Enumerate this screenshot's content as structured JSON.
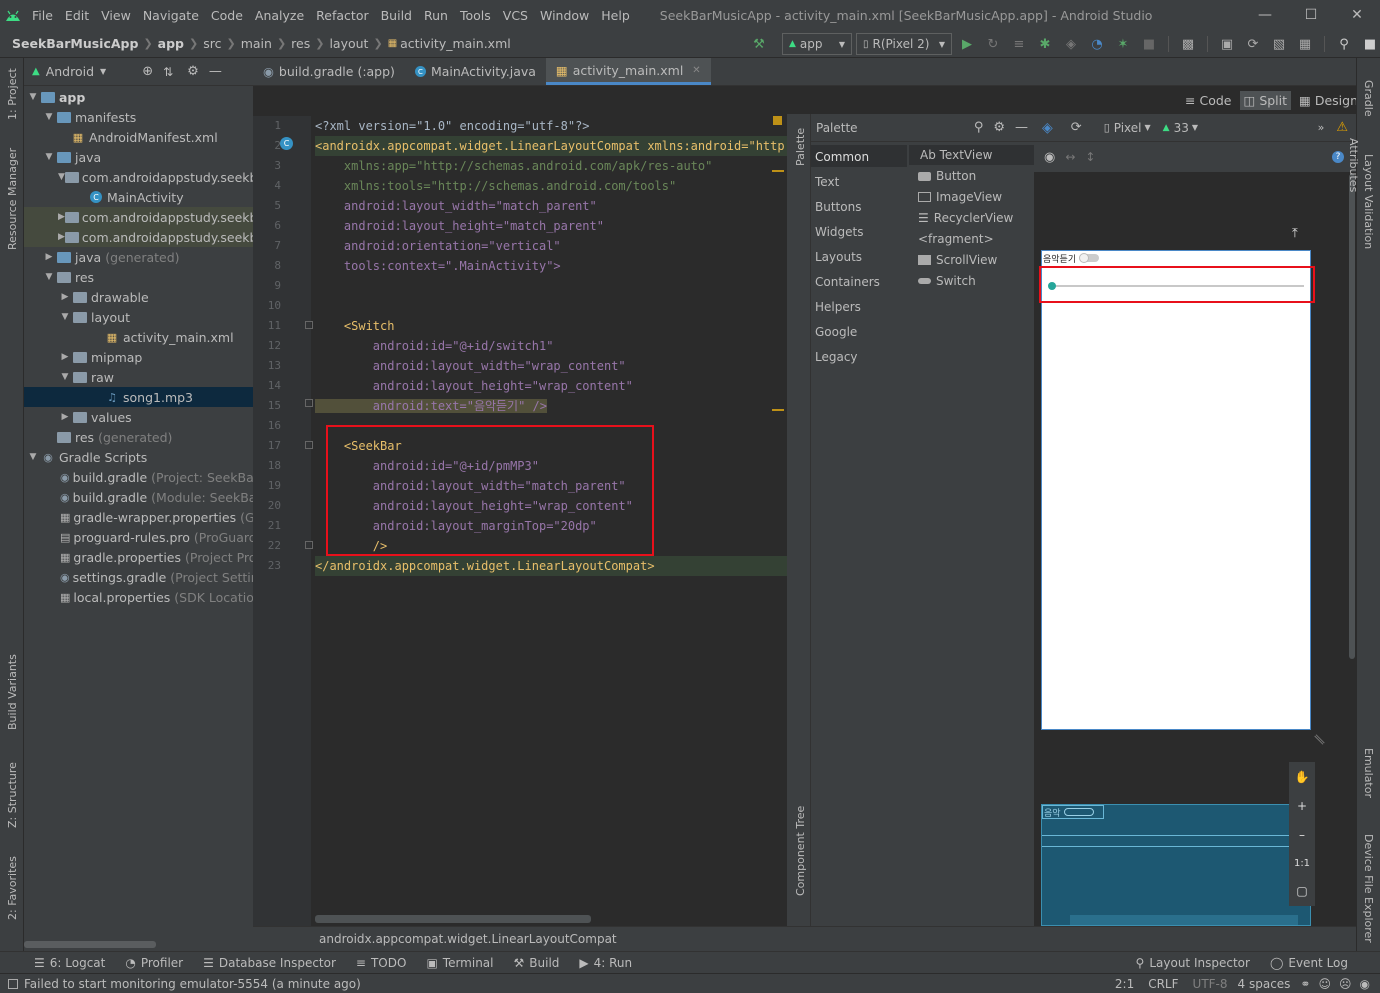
{
  "titlebar": {
    "menu": [
      "File",
      "Edit",
      "View",
      "Navigate",
      "Code",
      "Analyze",
      "Refactor",
      "Build",
      "Run",
      "Tools",
      "VCS",
      "Window",
      "Help"
    ],
    "title": "SeekBarMusicApp - activity_main.xml [SeekBarMusicApp.app] - Android Studio"
  },
  "navbar": {
    "breadcrumbs": [
      "SeekBarMusicApp",
      "app",
      "src",
      "main",
      "res",
      "layout",
      "activity_main.xml"
    ],
    "run_config": "app",
    "device": "R(Pixel 2)"
  },
  "left_stripe": {
    "project": "1: Project",
    "resource_manager": "Resource Manager",
    "build_variants": "Build Variants",
    "structure": "Z: Structure",
    "favorites": "2: Favorites"
  },
  "project_panel": {
    "view_mode": "Android",
    "tree": [
      {
        "label": "app",
        "hint": ""
      },
      {
        "label": "manifests",
        "hint": ""
      },
      {
        "label": "AndroidManifest.xml",
        "hint": ""
      },
      {
        "label": "java",
        "hint": ""
      },
      {
        "label": "com.androidappstudy.seekba",
        "hint": ""
      },
      {
        "label": "MainActivity",
        "hint": ""
      },
      {
        "label": "com.androidappstudy.seekba",
        "hint": ""
      },
      {
        "label": "com.androidappstudy.seekba",
        "hint": ""
      },
      {
        "label": "java",
        "hint": "(generated)"
      },
      {
        "label": "res",
        "hint": ""
      },
      {
        "label": "drawable",
        "hint": ""
      },
      {
        "label": "layout",
        "hint": ""
      },
      {
        "label": "activity_main.xml",
        "hint": ""
      },
      {
        "label": "mipmap",
        "hint": ""
      },
      {
        "label": "raw",
        "hint": ""
      },
      {
        "label": "song1.mp3",
        "hint": ""
      },
      {
        "label": "values",
        "hint": ""
      },
      {
        "label": "res",
        "hint": "(generated)"
      },
      {
        "label": "Gradle Scripts",
        "hint": ""
      },
      {
        "label": "build.gradle",
        "hint": "(Project: SeekBarMu"
      },
      {
        "label": "build.gradle",
        "hint": "(Module: SeekBarM"
      },
      {
        "label": "gradle-wrapper.properties",
        "hint": "(Gradl"
      },
      {
        "label": "proguard-rules.pro",
        "hint": "(ProGuard Ru"
      },
      {
        "label": "gradle.properties",
        "hint": "(Project Proper"
      },
      {
        "label": "settings.gradle",
        "hint": "(Project Settings)"
      },
      {
        "label": "local.properties",
        "hint": "(SDK Location)"
      }
    ]
  },
  "tabs": [
    {
      "label": "build.gradle (:app)"
    },
    {
      "label": "MainActivity.java"
    },
    {
      "label": "activity_main.xml"
    }
  ],
  "editor": {
    "line_numbers": [
      "1",
      "2",
      "3",
      "4",
      "5",
      "6",
      "7",
      "8",
      "9",
      "10",
      "11",
      "12",
      "13",
      "14",
      "15",
      "16",
      "17",
      "18",
      "19",
      "20",
      "21",
      "22",
      "23"
    ],
    "lines": [
      "<?xml version=\"1.0\" encoding=\"utf-8\"?>",
      "<androidx.appcompat.widget.LinearLayoutCompat xmlns:android=\"http:/",
      "    xmlns:app=\"http://schemas.android.com/apk/res-auto\"",
      "    xmlns:tools=\"http://schemas.android.com/tools\"",
      "    android:layout_width=\"match_parent\"",
      "    android:layout_height=\"match_parent\"",
      "    android:orientation=\"vertical\"",
      "    tools:context=\".MainActivity\">",
      "",
      "",
      "    <Switch",
      "        android:id=\"@+id/switch1\"",
      "        android:layout_width=\"wrap_content\"",
      "        android:layout_height=\"wrap_content\"",
      "        android:text=\"음악듣기\" />",
      "",
      "    <SeekBar",
      "        android:id=\"@+id/pmMP3\"",
      "        android:layout_width=\"match_parent\"",
      "        android:layout_height=\"wrap_content\"",
      "        android:layout_marginTop=\"20dp\"",
      "        />",
      "</androidx.appcompat.widget.LinearLayoutCompat>"
    ]
  },
  "view_modes": {
    "code": "Code",
    "split": "Split",
    "design": "Design"
  },
  "palette": {
    "title": "Palette",
    "categories": [
      "Common",
      "Text",
      "Buttons",
      "Widgets",
      "Layouts",
      "Containers",
      "Helpers",
      "Google",
      "Legacy"
    ],
    "items": [
      "Ab TextView",
      "Button",
      "ImageView",
      "RecyclerView",
      "<fragment>",
      "ScrollView",
      "Switch"
    ],
    "side_label": "Palette",
    "component_tree": "Component Tree"
  },
  "design": {
    "device": "Pixel",
    "api": "33",
    "switch_text": "음악듣기",
    "blueprint_switch_text": "음악",
    "zoom_fit": "1:1"
  },
  "right_stripe": {
    "gradle": "Gradle",
    "attributes": "Attributes",
    "layout_validation": "Layout Validation",
    "emulator": "Emulator",
    "device_file_explorer": "Device File Explorer"
  },
  "statusline": "androidx.appcompat.widget.LinearLayoutCompat",
  "toolwindows": [
    "6: Logcat",
    "Profiler",
    "Database Inspector",
    "TODO",
    "Terminal",
    "Build",
    "4: Run"
  ],
  "toolwindows_right": [
    "Layout Inspector",
    "Event Log"
  ],
  "statusbar": {
    "message": "Failed to start monitoring emulator-5554 (a minute ago)",
    "position": "2:1",
    "line_sep": "CRLF",
    "encoding": "UTF-8",
    "indent": "4 spaces"
  },
  "colors": {
    "highlight_red": "#e8101b",
    "accent_blue": "#4a88c7",
    "seekbar_teal": "#26a69a"
  }
}
